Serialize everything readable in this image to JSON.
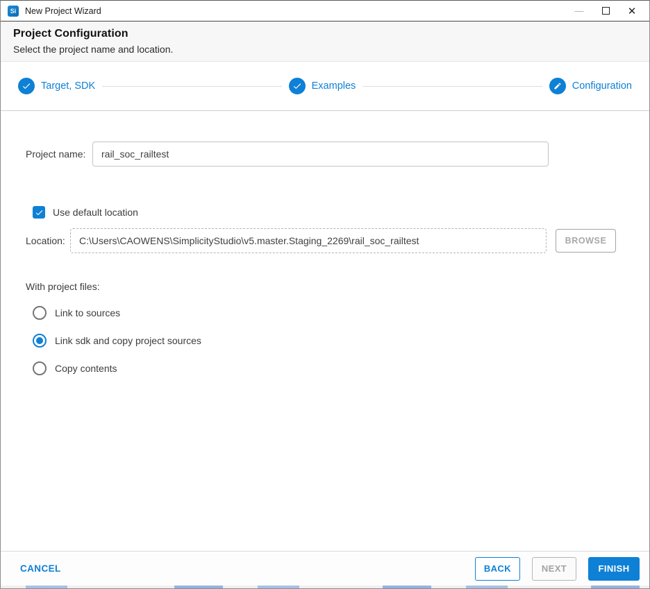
{
  "window": {
    "app_icon_text": "Si",
    "title": "New Project Wizard",
    "controls": {
      "minimize_glyph": "—",
      "close_glyph": "✕"
    }
  },
  "header": {
    "title": "Project Configuration",
    "subtitle": "Select the project name and location."
  },
  "stepper": {
    "steps": [
      {
        "label": "Target, SDK",
        "icon": "check-icon",
        "state": "complete"
      },
      {
        "label": "Examples",
        "icon": "check-icon",
        "state": "complete"
      },
      {
        "label": "Configuration",
        "icon": "pencil-icon",
        "state": "current"
      }
    ]
  },
  "form": {
    "project_name": {
      "label": "Project name:",
      "value": "rail_soc_railtest"
    },
    "use_default_location": {
      "label": "Use default location",
      "checked": true
    },
    "location": {
      "label": "Location:",
      "value": "C:\\Users\\CAOWENS\\SimplicityStudio\\v5.master.Staging_2269\\rail_soc_railtest",
      "browse_label": "BROWSE",
      "enabled": false
    },
    "with_project_files": {
      "label": "With project files:",
      "options": [
        {
          "label": "Link to sources",
          "selected": false
        },
        {
          "label": "Link sdk and copy project sources",
          "selected": true
        },
        {
          "label": "Copy contents",
          "selected": false
        }
      ]
    }
  },
  "footer": {
    "cancel_label": "CANCEL",
    "back_label": "BACK",
    "next_label": "NEXT",
    "finish_label": "FINISH",
    "next_enabled": false
  },
  "colors": {
    "accent_blue": "#0e80d5",
    "disabled_gray": "#a8a8a8",
    "header_background": "#f7f7f7"
  }
}
